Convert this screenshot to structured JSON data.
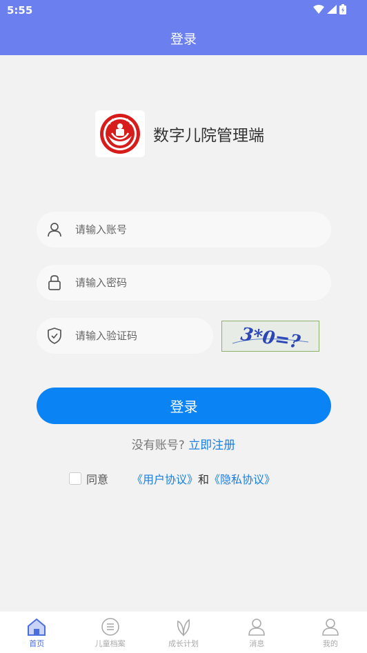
{
  "status_bar": {
    "time": "5:55"
  },
  "header": {
    "title": "登录"
  },
  "brand": {
    "app_name": "数字儿院管理端"
  },
  "form": {
    "account_placeholder": "请输入账号",
    "password_placeholder": "请输入密码",
    "captcha_placeholder": "请输入验证码",
    "captcha_text": "3*0=?"
  },
  "login_button": "登录",
  "register": {
    "prompt": "没有账号?",
    "link": "立即注册"
  },
  "agreement": {
    "agree_label": "同意",
    "user_protocol": "《用户协议》",
    "and": "和",
    "privacy_protocol": "《隐私协议》"
  },
  "tabbar": {
    "tabs": [
      {
        "label": "首页",
        "icon": "home-icon",
        "active": true
      },
      {
        "label": "儿童档案",
        "icon": "archive-icon",
        "active": false
      },
      {
        "label": "成长计划",
        "icon": "leaf-icon",
        "active": false
      },
      {
        "label": "消息",
        "icon": "user-icon",
        "active": false
      },
      {
        "label": "我的",
        "icon": "user-icon",
        "active": false
      }
    ]
  },
  "colors": {
    "header": "#6b7fee",
    "primary": "#0a84f5",
    "link": "#1a7fe0",
    "tab_active": "#4a6ee0"
  }
}
